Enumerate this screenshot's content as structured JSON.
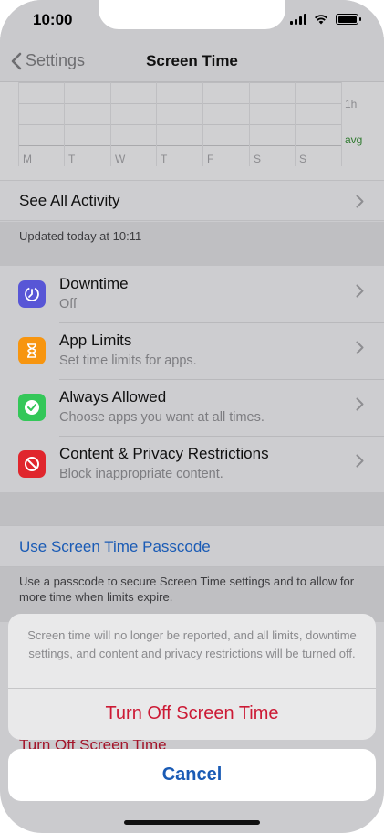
{
  "status_bar": {
    "time": "10:00"
  },
  "nav": {
    "back_label": "Settings",
    "title": "Screen Time"
  },
  "chart": {
    "days": [
      "M",
      "T",
      "W",
      "T",
      "F",
      "S",
      "S"
    ],
    "label_1h": "1h",
    "label_avg": "avg",
    "avg_color": "#2f7a2f"
  },
  "see_all": {
    "label": "See All Activity"
  },
  "updated": {
    "text": "Updated today at 10:11"
  },
  "items": [
    {
      "title": "Downtime",
      "subtitle": "Off",
      "icon": "downtime-icon",
      "color": "#5856d6"
    },
    {
      "title": "App Limits",
      "subtitle": "Set time limits for apps.",
      "icon": "hourglass-icon",
      "color": "#f7950f"
    },
    {
      "title": "Always Allowed",
      "subtitle": "Choose apps you want at all times.",
      "icon": "checkmark-badge-icon",
      "color": "#34c759"
    },
    {
      "title": "Content & Privacy Restrictions",
      "subtitle": "Block inappropriate content.",
      "icon": "restriction-icon",
      "color": "#e0262d"
    }
  ],
  "passcode": {
    "link": "Use Screen Time Passcode",
    "footer": "Use a passcode to secure Screen Time settings and to allow for more time when limits expire."
  },
  "behind": {
    "turn_off": "Turn Off Screen Time"
  },
  "action_sheet": {
    "message": "Screen time will no longer be reported, and all limits, downtime settings, and content and privacy restrictions will be turned off.",
    "destructive": "Turn Off Screen Time",
    "cancel": "Cancel",
    "destructive_color": "#cc1a35",
    "cancel_color": "#1a5bb5"
  }
}
